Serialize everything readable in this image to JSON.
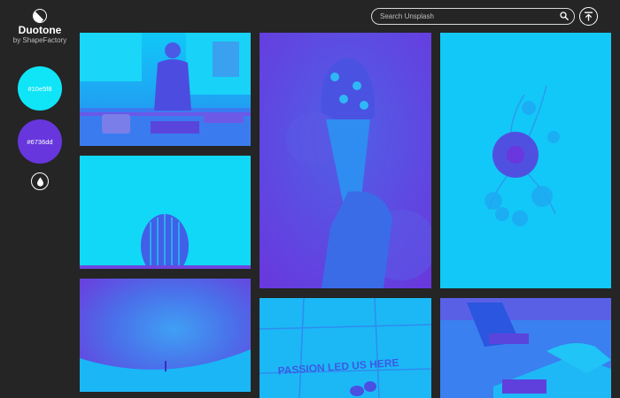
{
  "app": {
    "name": "Duotone",
    "byline": "by ShapeFactory"
  },
  "colors": {
    "primary": "#10e5f8",
    "secondary": "#6736dd"
  },
  "swatches": [
    {
      "label": "#10e5f8",
      "color": "#10e5f8"
    },
    {
      "label": "#6736dd",
      "color": "#6736dd"
    }
  ],
  "icons": {
    "logo": "duotone-logo-icon",
    "drop": "drop-icon",
    "search": "search-icon",
    "scroll_top": "scroll-to-top-icon"
  },
  "search": {
    "placeholder": "Search Unsplash",
    "value": ""
  },
  "photos": [
    {
      "subject": "man cooking in kitchen"
    },
    {
      "subject": "cactus"
    },
    {
      "subject": "person under night sky"
    },
    {
      "subject": "hand holding ice cream cone"
    },
    {
      "subject": "wall sign",
      "text": "PASSION LED US HERE"
    },
    {
      "subject": "flower"
    },
    {
      "subject": "hands on laptop"
    }
  ]
}
